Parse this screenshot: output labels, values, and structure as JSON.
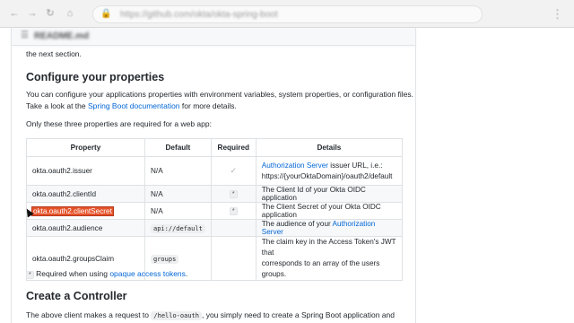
{
  "browser": {
    "url": "https://github.com/okta/okta-spring-boot"
  },
  "file_header": {
    "title": "README.md"
  },
  "intro_text": "the next section.",
  "section1": {
    "heading": "Configure your properties",
    "para1_before": "You can configure your applications properties with environment variables, system properties, or configuration files.",
    "para1_line2_before": "Take a look at the ",
    "para1_link": "Spring Boot documentation",
    "para1_after": " for more details.",
    "para2": "Only these three properties are required for a web app:"
  },
  "table": {
    "headers": [
      "Property",
      "Default",
      "Required",
      "Details"
    ],
    "rows": [
      {
        "property": "okta.oauth2.issuer",
        "default": "N/A",
        "required": "check",
        "details_link": "Authorization Server",
        "details_text": " issuer URL, i.e.:",
        "details_line2": "https://{yourOktaDomain}/oauth2/default"
      },
      {
        "property": "okta.oauth2.clientId",
        "default": "N/A",
        "required": "*",
        "details_text": "The Client Id of your Okta OIDC application"
      },
      {
        "property": "okta.oauth2.clientSecret",
        "default": "N/A",
        "required": "*",
        "details_text": "The Client Secret of your Okta OIDC application"
      },
      {
        "property": "okta.oauth2.audience",
        "default": "api://default",
        "required": "",
        "details_text": "The audience of your ",
        "details_link": "Authorization Server"
      },
      {
        "property": "okta.oauth2.groupsClaim",
        "default": "groups",
        "required": "",
        "details_text": "The claim key in the Access Token's JWT that",
        "details_line2": "corresponds to an array of the users groups."
      }
    ]
  },
  "footnote": {
    "marker": "*",
    "text": " Required when using ",
    "link": "opaque access tokens",
    "end": "."
  },
  "section2": {
    "heading": "Create a Controller",
    "para_before": "The above client makes a request to ",
    "code": "/hello-oauth",
    "para_after": ", you simply need to create a Spring Boot application and"
  },
  "colors": {
    "link": "#0366d6",
    "selection": "#e5542b",
    "text": "#24292e"
  }
}
